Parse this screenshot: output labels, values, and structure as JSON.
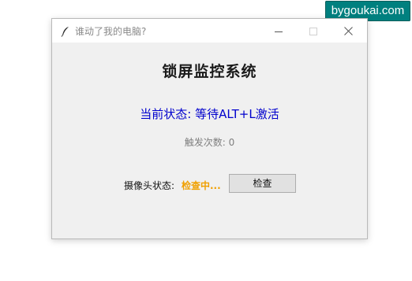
{
  "watermark": {
    "text": "bygoukai.com"
  },
  "window": {
    "title": "谁动了我的电脑?",
    "icon": "feather-icon",
    "controls": {
      "minimize": "minimize-icon",
      "maximize": "maximize-icon",
      "close": "close-icon"
    }
  },
  "main": {
    "heading": "锁屏监控系统",
    "status": "当前状态: 等待ALT+L激活",
    "trigger_count": "触发次数: 0",
    "camera_label": "摄像头状态:",
    "camera_value": "检查中...",
    "check_button": "检查"
  },
  "colors": {
    "status": "#0000cd",
    "camera_value": "#f0a000",
    "watermark_bg": "#00807f"
  }
}
